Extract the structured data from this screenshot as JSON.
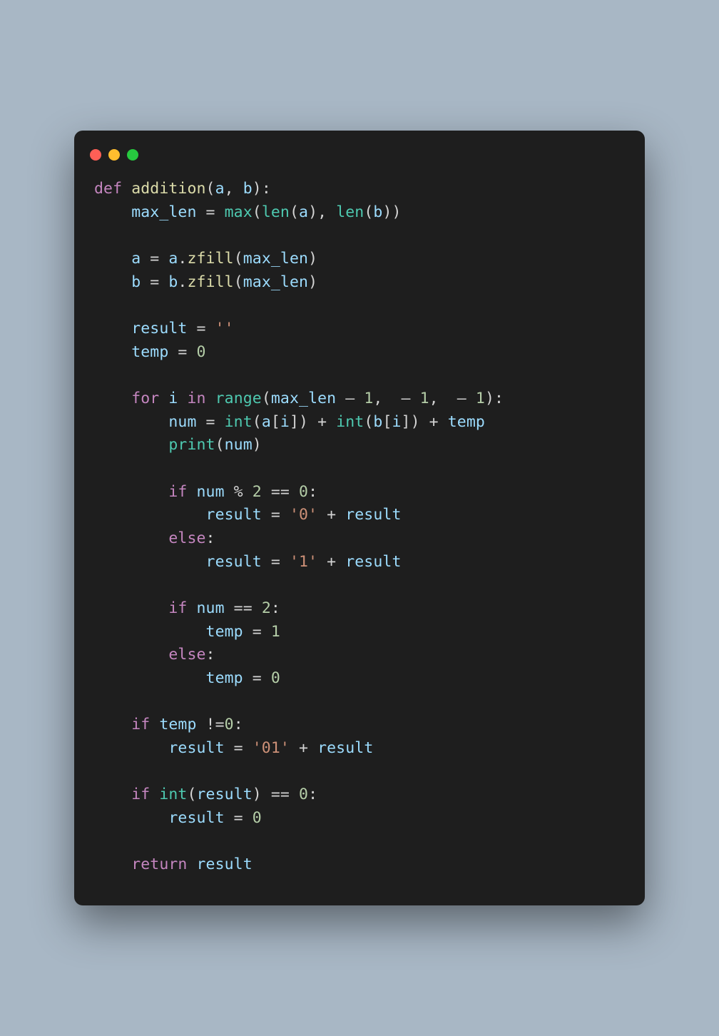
{
  "window": {
    "traffic": {
      "red": "#ff5f56",
      "yellow": "#ffbd2e",
      "green": "#27c93f"
    }
  },
  "code": {
    "t": {
      "def": "def",
      "for": "for",
      "in": "in",
      "if": "if",
      "else": "else",
      "return": "return",
      "addition": "addition",
      "zfill": "zfill",
      "max": "max",
      "len": "len",
      "range": "range",
      "int": "int",
      "print": "print",
      "a": "a",
      "b": "b",
      "i": "i",
      "max_len": "max_len",
      "result": "result",
      "temp": "temp",
      "num": "num",
      "n0": "0",
      "n1": "1",
      "n2": "2",
      "s_empty": "''",
      "s_0": "'0'",
      "s_1": "'1'",
      "s_01": "'01'",
      "lp": "(",
      "rp": ")",
      "lb": "[",
      "rb": "]",
      "comma_sp": ", ",
      "colon": ":",
      "dot": ".",
      "eq_sp": " = ",
      "eqeq_sp": " == ",
      "ne": " !=",
      "plus_sp": " + ",
      "mod_sp": " % ",
      "minus_sp": " - ",
      "msp_minus_sp": " – ",
      "sp": " ",
      "ind1": "    ",
      "ind2": "        ",
      "ind3": "            "
    }
  }
}
